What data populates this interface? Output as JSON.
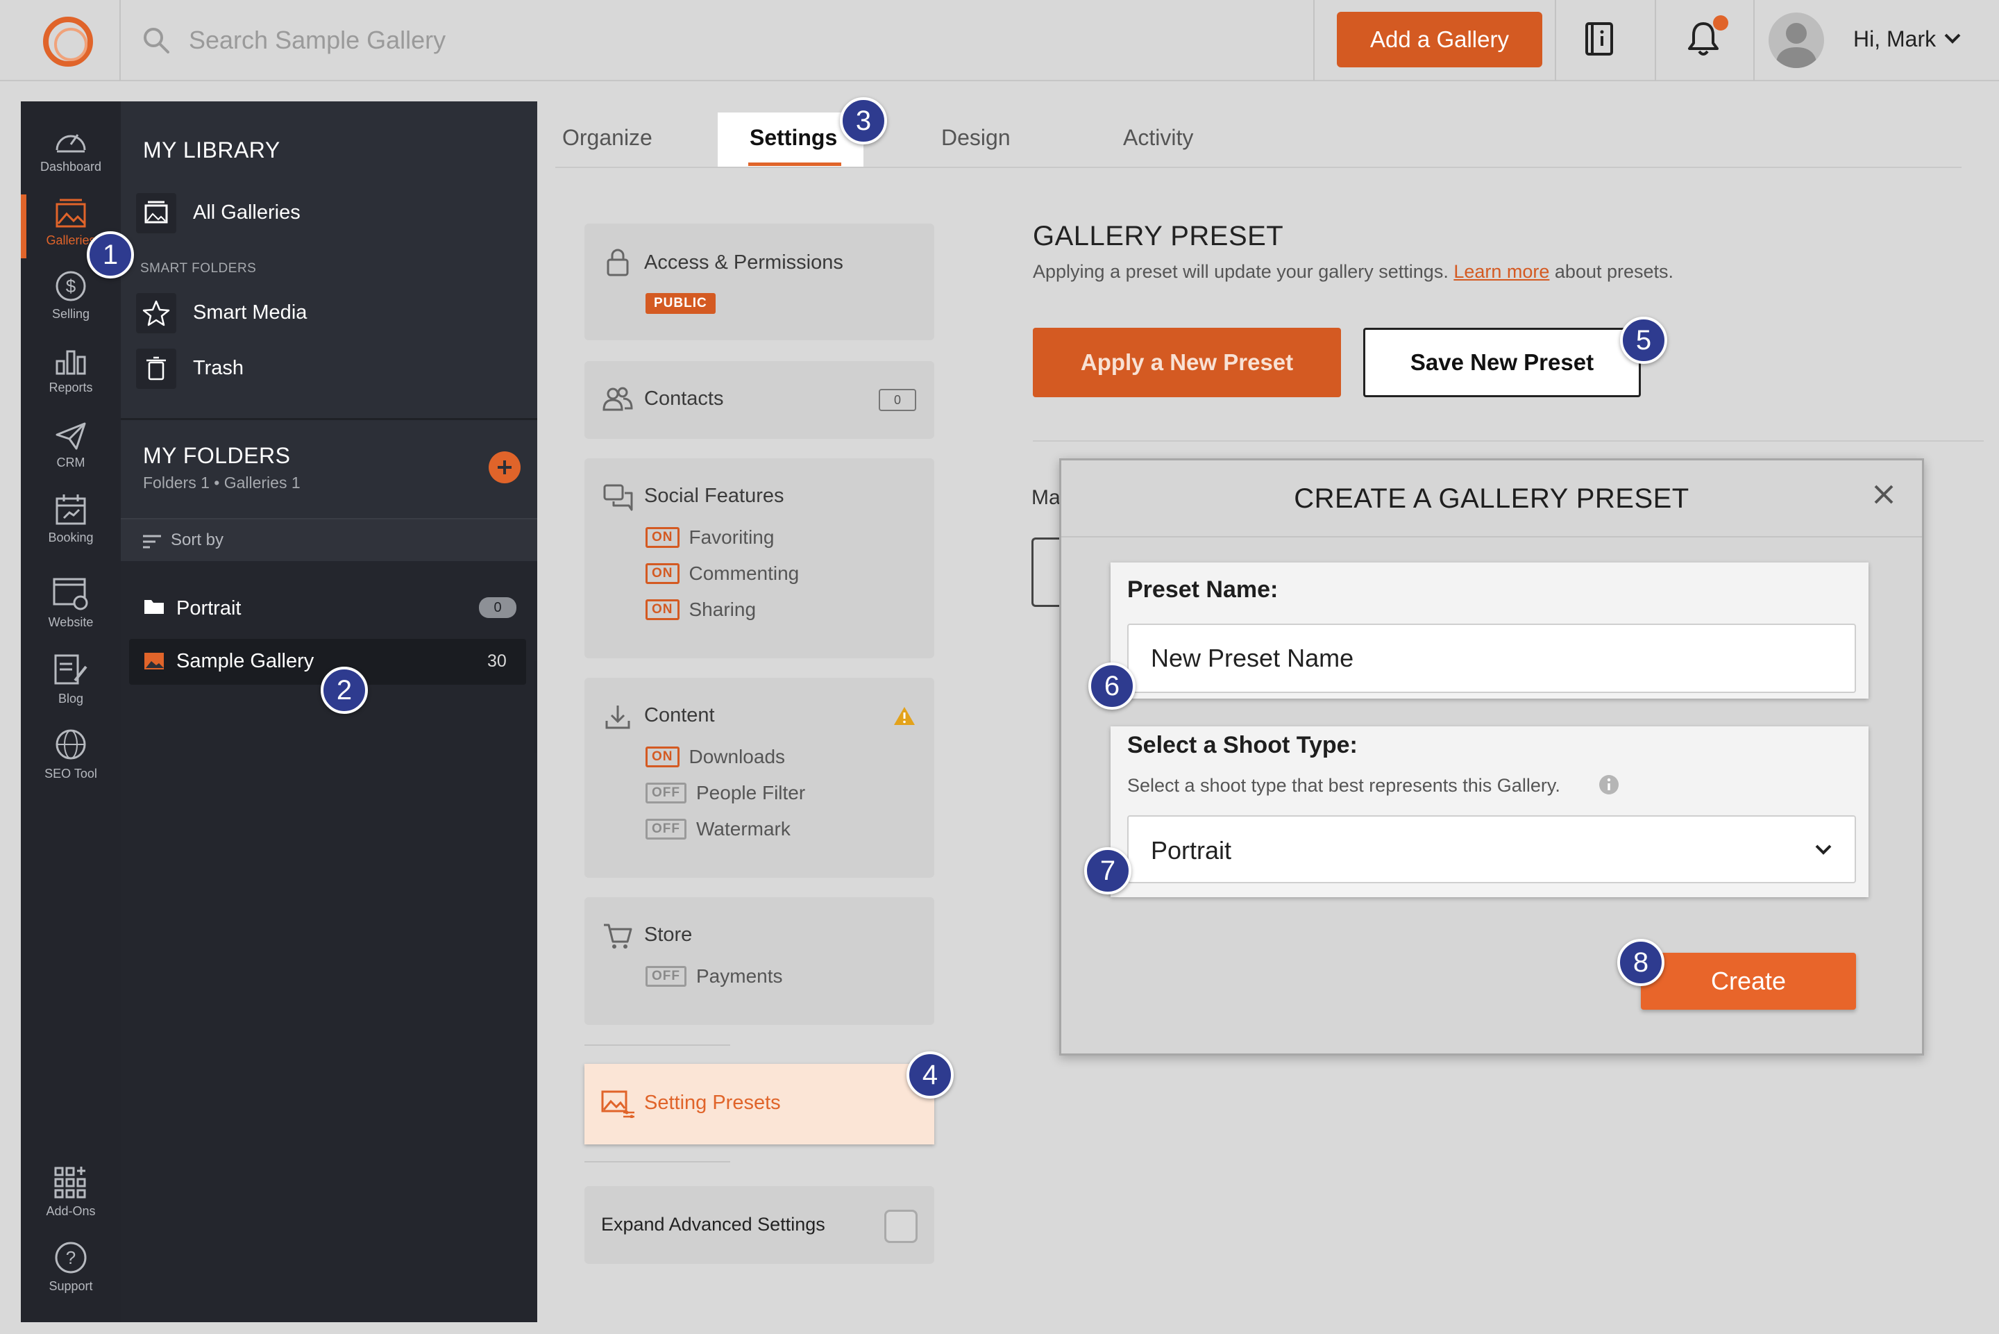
{
  "topbar": {
    "search_placeholder": "Search Sample Gallery",
    "add_gallery_label": "Add a Gallery",
    "user_greeting": "Hi, Mark"
  },
  "rail": {
    "items": [
      {
        "label": "Dashboard",
        "icon": "speedometer-icon"
      },
      {
        "label": "Galleries",
        "icon": "gallery-icon",
        "active": true
      },
      {
        "label": "Selling",
        "icon": "dollar-icon"
      },
      {
        "label": "Reports",
        "icon": "bar-chart-icon"
      },
      {
        "label": "CRM",
        "icon": "paper-plane-icon"
      },
      {
        "label": "Booking",
        "icon": "calendar-icon"
      },
      {
        "label": "Website",
        "icon": "website-icon"
      },
      {
        "label": "Blog",
        "icon": "blog-icon"
      },
      {
        "label": "SEO Tool",
        "icon": "seo-globe-icon"
      },
      {
        "label": "Add-Ons",
        "icon": "add-ons-grid-icon"
      },
      {
        "label": "Support",
        "icon": "help-circle-icon"
      }
    ]
  },
  "library": {
    "heading": "MY LIBRARY",
    "all_galleries": "All Galleries",
    "smart_folders_label": "SMART FOLDERS",
    "smart_media": "Smart Media",
    "trash": "Trash",
    "folders_heading": "MY FOLDERS",
    "folders_meta": "Folders 1 • Galleries 1",
    "sort_by": "Sort by",
    "folder_portrait": "Portrait",
    "folder_portrait_count": "0",
    "sample_gallery": "Sample Gallery",
    "sample_gallery_count": "30"
  },
  "tabs": {
    "organize": "Organize",
    "settings": "Settings",
    "design": "Design",
    "activity": "Activity"
  },
  "settings_nav": {
    "access": {
      "title": "Access & Permissions",
      "badge": "PUBLIC"
    },
    "contacts": {
      "title": "Contacts",
      "count": "0"
    },
    "social": {
      "title": "Social Features",
      "options": [
        {
          "state": "ON",
          "label": "Favoriting"
        },
        {
          "state": "ON",
          "label": "Commenting"
        },
        {
          "state": "ON",
          "label": "Sharing"
        }
      ]
    },
    "content": {
      "title": "Content",
      "options": [
        {
          "state": "ON",
          "label": "Downloads"
        },
        {
          "state": "OFF",
          "label": "People Filter"
        },
        {
          "state": "OFF",
          "label": "Watermark"
        }
      ]
    },
    "store": {
      "title": "Store",
      "options": [
        {
          "state": "OFF",
          "label": "Payments"
        }
      ]
    },
    "setting_presets": "Setting Presets",
    "expand_advanced": "Expand Advanced Settings"
  },
  "gallery_preset": {
    "heading": "GALLERY PRESET",
    "desc_before": "Applying a preset will update your gallery settings. ",
    "learn_more": "Learn more",
    "desc_after": " about presets.",
    "apply_label": "Apply a New Preset",
    "save_label": "Save New Preset",
    "behind_text": "Ma"
  },
  "modal": {
    "title": "CREATE A GALLERY PRESET",
    "preset_name_label": "Preset Name:",
    "preset_name_value": "New Preset Name",
    "shoot_type_label": "Select a Shoot Type:",
    "shoot_type_help": "Select a shoot type that best represents this Gallery.",
    "shoot_type_value": "Portrait",
    "create_label": "Create"
  },
  "steps": [
    "1",
    "2",
    "3",
    "4",
    "5",
    "6",
    "7",
    "8"
  ],
  "colors": {
    "accent": "#e0642a",
    "accent_dark": "#d45a22",
    "rail_bg": "#23252c",
    "panel_bg": "#2c2f37",
    "step_marker": "#2e3b8f"
  }
}
